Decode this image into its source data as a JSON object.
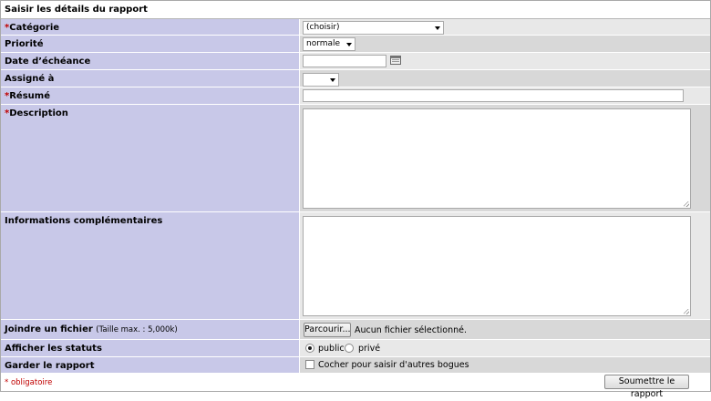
{
  "form": {
    "title": "Saisir les détails du rapport",
    "required_mark": "*",
    "required_note": "* obligatoire",
    "submit_label": "Soumettre le rapport"
  },
  "fields": {
    "category": {
      "label": "Catégorie",
      "value": "(choisir)"
    },
    "priority": {
      "label": "Priorité",
      "value": "normale"
    },
    "due_date": {
      "label": "Date d’échéance",
      "value": "",
      "icon": "calendar-icon"
    },
    "assigned": {
      "label": "Assigné à",
      "value": ""
    },
    "summary": {
      "label": "Résumé",
      "value": ""
    },
    "description": {
      "label": "Description",
      "value": ""
    },
    "additional": {
      "label": "Informations complémentaires",
      "value": ""
    },
    "attach": {
      "label": "Joindre un fichier",
      "max_size": "(Taille max. : 5,000k)",
      "browse_label": "Parcourir...",
      "no_file": "Aucun fichier sélectionné."
    },
    "visibility": {
      "label": "Afficher les statuts",
      "options": [
        "public",
        "privé"
      ],
      "selected": "public"
    },
    "keep_report": {
      "label": "Garder le rapport",
      "checkbox_label": "Cocher pour saisir d'autres bogues",
      "checked": false
    }
  },
  "colors": {
    "label_bg": "#c8c8e8",
    "row_bg_light": "#e8e8e8",
    "row_bg_dark": "#d8d8d8",
    "required": "#c00000"
  }
}
